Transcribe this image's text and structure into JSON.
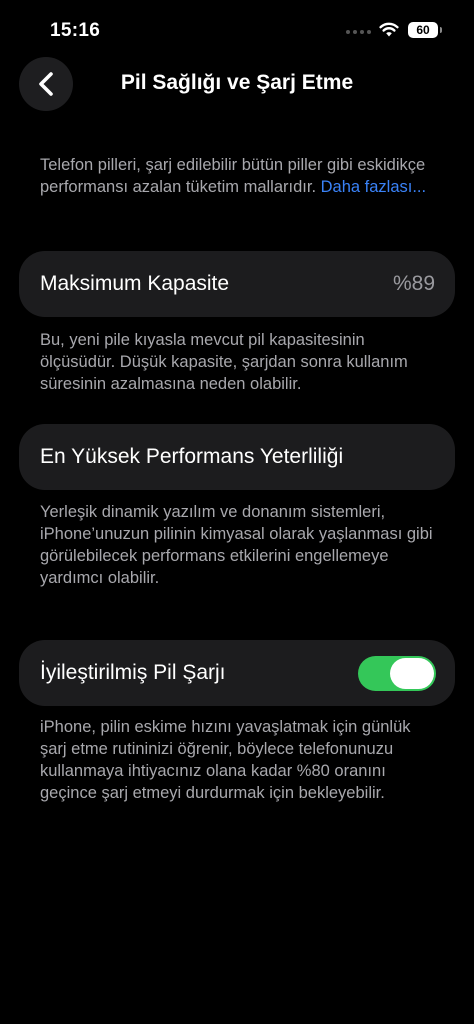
{
  "status_bar": {
    "time": "15:16",
    "battery_level": "60",
    "icons": [
      "cellular-signal-icon",
      "wifi-icon",
      "battery-icon"
    ]
  },
  "nav": {
    "title": "Pil Sağlığı ve Şarj Etme",
    "back_icon": "chevron-left-icon"
  },
  "intro": {
    "text": "Telefon pilleri, şarj edilebilir bütün piller gibi eskidikçe performansı azalan tüketim mallarıdır.",
    "link": "Daha fazlası..."
  },
  "max_capacity": {
    "label": "Maksimum Kapasite",
    "value": "%89",
    "description": "Bu, yeni pile kıyasla mevcut pil kapasitesinin ölçüsüdür. Düşük kapasite, şarjdan sonra kullanım süresinin azalmasına neden olabilir."
  },
  "peak_performance": {
    "label": "En Yüksek Performans Yeterliliği",
    "description": "Yerleşik dinamik yazılım ve donanım sistemleri, iPhone’unuzun pilinin kimyasal olarak yaşlanması gibi görülebilecek performans etkilerini engellemeye yardımcı olabilir."
  },
  "optimized_charging": {
    "label": "İyileştirilmiş Pil Şarjı",
    "enabled": true,
    "description": "iPhone, pilin eskime hızını yavaşlatmak için günlük şarj etme rutininizi öğrenir, böylece telefonunuzu kullanmaya ihtiyacınız olana kadar %80 oranını geçince şarj etmeyi durdurmak için bekleyebilir."
  },
  "colors": {
    "background": "#000000",
    "card": "#1c1c1e",
    "secondary_text": "#a8a8ad",
    "link": "#3a82f7",
    "toggle_on": "#34c759"
  }
}
